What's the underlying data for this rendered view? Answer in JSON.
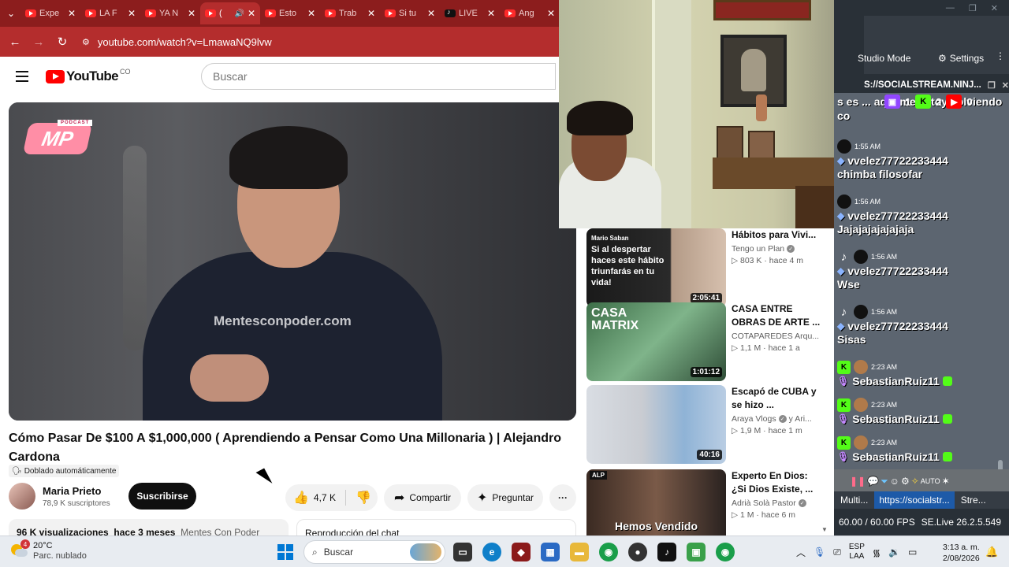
{
  "browser": {
    "tabs": [
      {
        "title": "Expe",
        "icon": "youtube-icon"
      },
      {
        "title": "LA F",
        "icon": "youtube-icon"
      },
      {
        "title": "YA N",
        "icon": "youtube-icon"
      },
      {
        "title": "(",
        "icon": "youtube-icon",
        "active": true
      },
      {
        "title": "Esto",
        "icon": "youtube-icon"
      },
      {
        "title": "Trab",
        "icon": "youtube-icon"
      },
      {
        "title": "Si tu",
        "icon": "youtube-icon"
      },
      {
        "title": "LIVE",
        "icon": "tiktok-icon"
      },
      {
        "title": "Ang",
        "icon": "youtube-icon"
      }
    ],
    "url": "youtube.com/watch?v=LmawaNQ9lvw"
  },
  "youtube": {
    "logo_text": "YouTube",
    "country": "CO",
    "search_placeholder": "Buscar",
    "watermark": "Mentesconpoder.com",
    "podcast_logo": "MP",
    "podcast_tag": "PODCAST",
    "video_title": "Cómo Pasar De $100 A $1,000,000 ( Aprendiendo a Pensar Como Una Millonaria ) | Alejandro Cardona",
    "dubbed_label": "Doblado automáticamente",
    "channel_name": "Maria Prieto",
    "subscribers": "78,9 K suscriptores",
    "subscribe_label": "Suscribirse",
    "likes": "4,7 K",
    "share_label": "Compartir",
    "ask_label": "Preguntar",
    "description_views": "96 K visualizaciones",
    "description_age": "hace 3 meses",
    "description_tags": "Mentes Con Poder",
    "chat_replay_label": "Reproducción del chat"
  },
  "related": [
    {
      "title": "Hábitos para Vivi...",
      "channel": "Tengo un Plan",
      "verified": true,
      "views": "803 K",
      "age": "hace 4 m",
      "duration": "2:05:41",
      "thumb_text": "Si al despertar haces este hábito triunfarás en tu vida!",
      "thumb_name": "Mario Saban"
    },
    {
      "title": "CASA ENTRE OBRAS DE ARTE ...",
      "channel": "COTAPAREDES Arqu...",
      "verified": false,
      "views": "1,1 M",
      "age": "hace 1 a",
      "duration": "1:01:12",
      "thumb_text": "CASA MATRIX"
    },
    {
      "title": "Escapó de CUBA y se hizo ...",
      "channel": "Araya Vlogs",
      "channel_extra": "y Ari...",
      "verified": true,
      "views": "1,9 M",
      "age": "hace 1 m",
      "duration": "40:16"
    },
    {
      "title": "Experto En Dios: ¿Si Dios Existe, ...",
      "channel": "Adrià Solà Pastor",
      "verified": true,
      "views": "1 M",
      "age": "hace 6 m",
      "duration": "",
      "thumb_text": "Hemos Vendido",
      "thumb_badge": "ALP"
    }
  ],
  "socialstream": {
    "mode_label": "Studio Mode",
    "settings_label": "Settings",
    "url_text": "S://SOCIALSTREAM.NINJ...",
    "counts": {
      "twitch": "1",
      "kick": "2",
      "youtube": "0"
    },
    "top_text": "s es ... aqui me estoy volviendo co",
    "messages": [
      {
        "platform": "tiktok",
        "time": "1:55 AM",
        "user": "vvelez77722233444",
        "text": "chimba filosofar"
      },
      {
        "platform": "tiktok",
        "time": "1:56 AM",
        "user": "vvelez77722233444",
        "text": "Jajajajajajajaja"
      },
      {
        "platform": "tiktok",
        "time": "1:56 AM",
        "user": "vvelez77722233444",
        "text": "Wse"
      },
      {
        "platform": "tiktok",
        "time": "1:56 AM",
        "user": "vvelez77722233444",
        "text": "Sisas"
      },
      {
        "platform": "kick",
        "time": "2:23 AM",
        "user": "SebastianRuiz11",
        "text": ""
      },
      {
        "platform": "kick",
        "time": "2:23 AM",
        "user": "SebastianRuiz11",
        "text": ""
      },
      {
        "platform": "kick",
        "time": "2:23 AM",
        "user": "SebastianRuiz11",
        "text": ""
      }
    ],
    "tabs": [
      "Multi...",
      "https://socialstr...",
      "Stre..."
    ],
    "fps": "60.00 / 60.00 FPS",
    "version": "SE.Live 26.2.5.549"
  },
  "taskbar": {
    "temperature": "20°C",
    "weather": "Parc. nublado",
    "weather_alert": "4",
    "search_label": "Buscar",
    "lang_top": "ESP",
    "lang_bottom": "LAA",
    "time": "3:13 a. m.",
    "date": "2/08/2026"
  }
}
